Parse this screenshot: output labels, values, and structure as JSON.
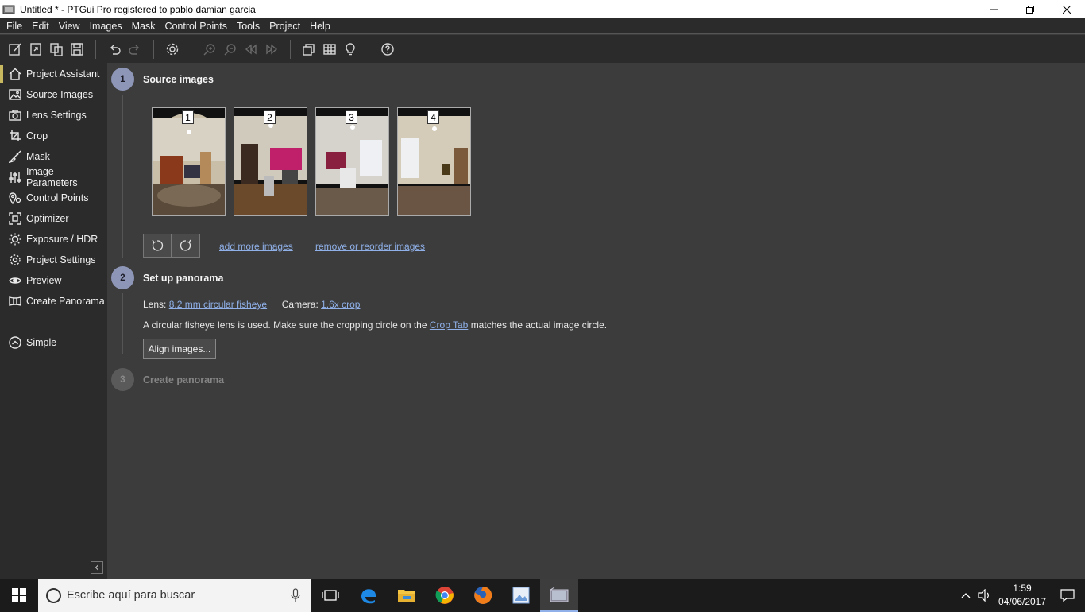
{
  "window": {
    "title": "Untitled * - PTGui Pro registered to pablo damian garcia"
  },
  "menu": [
    "File",
    "Edit",
    "View",
    "Images",
    "Mask",
    "Control Points",
    "Tools",
    "Project",
    "Help"
  ],
  "toolbar": {
    "icons": [
      "new-project-icon",
      "open-icon",
      "duplicate-icon",
      "save-icon",
      "undo-icon",
      "redo-icon",
      "settings-icon",
      "zoom-in-icon",
      "zoom-out-icon",
      "previous-icon",
      "next-icon",
      "panorama-editor-icon",
      "table-icon",
      "tip-icon",
      "help-icon"
    ]
  },
  "sidebar": {
    "items": [
      {
        "label": "Project Assistant",
        "icon": "home-icon",
        "active": true
      },
      {
        "label": "Source Images",
        "icon": "image-icon"
      },
      {
        "label": "Lens Settings",
        "icon": "camera-icon"
      },
      {
        "label": "Crop",
        "icon": "crop-icon"
      },
      {
        "label": "Mask",
        "icon": "brush-icon"
      },
      {
        "label": "Image Parameters",
        "icon": "sliders-icon"
      },
      {
        "label": "Control Points",
        "icon": "control-points-icon"
      },
      {
        "label": "Optimizer",
        "icon": "optimizer-icon"
      },
      {
        "label": "Exposure / HDR",
        "icon": "sun-icon"
      },
      {
        "label": "Project Settings",
        "icon": "gear-icon"
      },
      {
        "label": "Preview",
        "icon": "eye-icon"
      },
      {
        "label": "Create Panorama",
        "icon": "panorama-icon"
      }
    ],
    "simple_label": "Simple"
  },
  "steps": {
    "step1": {
      "number": "1",
      "title": "Source images"
    },
    "step2": {
      "number": "2",
      "title": "Set up panorama"
    },
    "step3": {
      "number": "3",
      "title": "Create panorama"
    }
  },
  "images": [
    {
      "number": "1"
    },
    {
      "number": "2"
    },
    {
      "number": "3"
    },
    {
      "number": "4"
    }
  ],
  "links": {
    "add_more": "add more images",
    "remove_reorder": "remove or reorder images"
  },
  "setup": {
    "lens_label": "Lens:",
    "lens_value": "8.2 mm circular fisheye",
    "camera_label": "Camera:",
    "camera_value": "1.6x crop",
    "hint_before": "A circular fisheye lens is used. Make sure the cropping circle on the",
    "hint_link": "Crop Tab",
    "hint_after": "matches the actual image circle.",
    "align_button": "Align images..."
  },
  "taskbar": {
    "search_placeholder": "Escribe aquí para buscar",
    "time": "1:59",
    "date": "04/06/2017"
  },
  "colors": {
    "accent": "#8fb0e8",
    "step_circle": "#8e96b8",
    "active_marker": "#c8b860"
  }
}
